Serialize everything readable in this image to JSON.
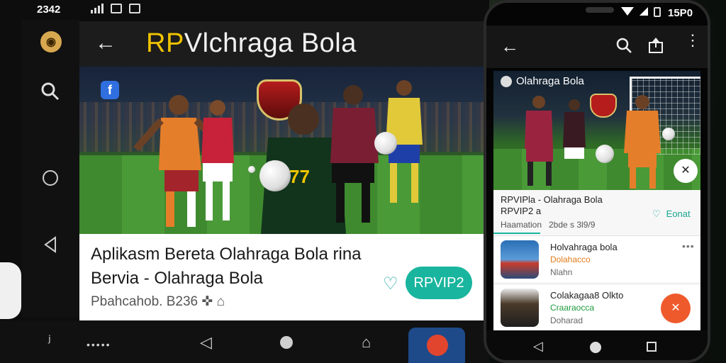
{
  "tablet": {
    "status": {
      "time": "2342"
    },
    "appbar": {
      "title_highlight": "RP",
      "title_rest": "Vlchraga Bola"
    },
    "card": {
      "title_line1": "Aplikasm Bereta Olahraga Bola rina",
      "title_line2": "Bervia - Olahraga Bola",
      "meta": "Pbahcahob. B236",
      "promo_button": "RPVIP2"
    }
  },
  "phone": {
    "status": {
      "time": "15P0"
    },
    "hero_title": "Olahraga Bola",
    "card": {
      "line1": "RPVIPla - Olahraga Bola",
      "line2": "RPVIP2 a",
      "meta_left": "Haamation",
      "meta_right": "2bde s 3l9/9",
      "like_label": "Eonat"
    },
    "rows": [
      {
        "title": "Holvahraga bola",
        "subtitle": "Dolahacco",
        "detail": "Nlahn",
        "subtitle_color": "#e07b1a"
      },
      {
        "title": "Colakagaa8 Olkto",
        "subtitle": "Craaraocca",
        "detail": "Doharad",
        "subtitle_color": "#1e9a3c"
      }
    ]
  }
}
